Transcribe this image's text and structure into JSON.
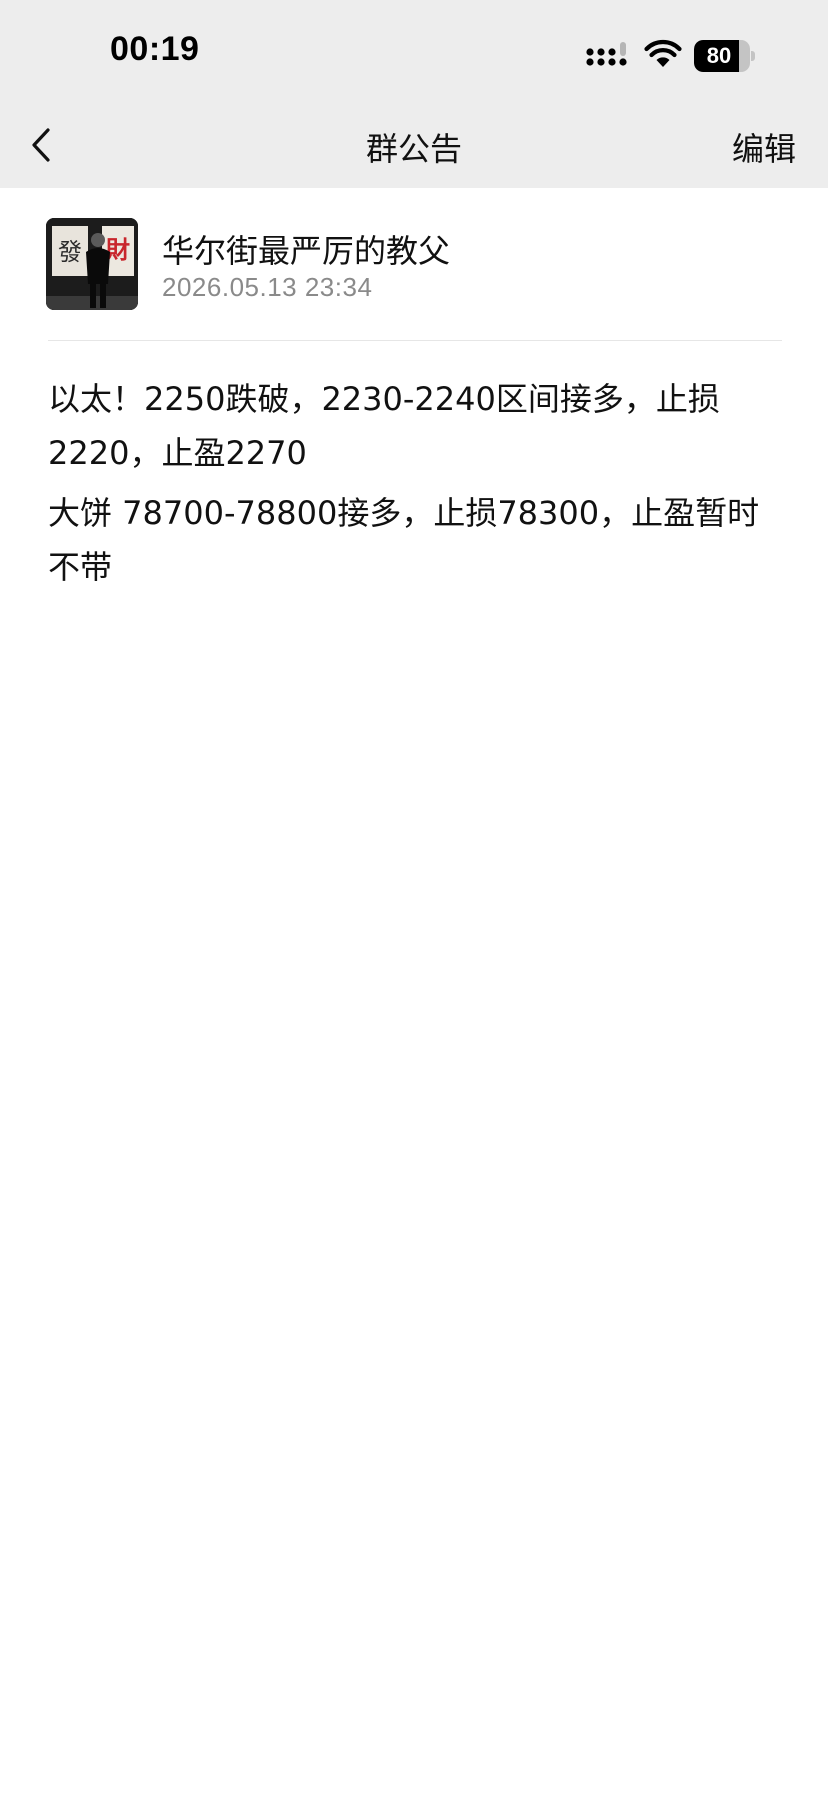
{
  "status_bar": {
    "time": "00:19",
    "battery_level": "80",
    "battery_fraction": 0.8,
    "icons": [
      "cellular-signal-icon",
      "wifi-icon",
      "battery-icon"
    ]
  },
  "nav": {
    "title": "群公告",
    "edit_label": "编辑",
    "back_icon": "chevron-left-icon"
  },
  "announcement": {
    "author_name": "华尔街最严厉的教父",
    "timestamp": "2026.05.13  23:34",
    "avatar": {
      "chars": [
        "發",
        "財"
      ]
    },
    "paragraphs": [
      "以太！2250跌破，2230-2240区间接多，止损2220，止盈2270",
      "大饼  78700-78800接多，止损78300，止盈暂时不带"
    ]
  },
  "colors": {
    "header_bg": "#ededed",
    "body_bg": "#ffffff",
    "text": "#111111",
    "secondary_text": "#8a8a8a",
    "divider": "#e6e6e6",
    "avatar_red": "#c8262c"
  }
}
